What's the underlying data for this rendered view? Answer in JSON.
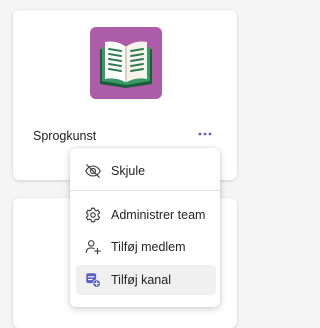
{
  "team": {
    "name": "Sprogkunst",
    "tile_color": "#ad5ca8",
    "icon": "open-book-icon"
  },
  "menu": {
    "items": [
      {
        "label": "Skjule",
        "icon": "eye-off-icon"
      },
      {
        "label": "Administrer team",
        "icon": "gear-icon"
      },
      {
        "label": "Tilføj medlem",
        "icon": "add-person-icon"
      },
      {
        "label": "Tilføj kanal",
        "icon": "add-channel-icon",
        "highlighted": true
      }
    ]
  },
  "colors": {
    "accent": "#5b5fc7",
    "text": "#242424",
    "menu_hover": "#f0f0f0"
  }
}
